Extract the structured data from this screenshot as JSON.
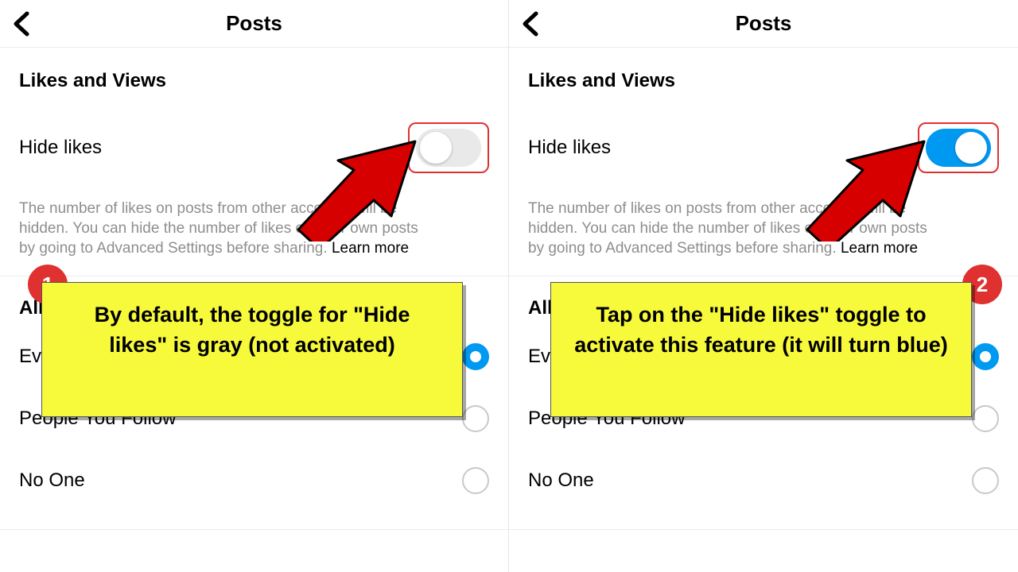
{
  "left": {
    "header_title": "Posts",
    "section_title": "Likes and Views",
    "hide_likes_label": "Hide likes",
    "toggle_on": false,
    "desc_line1": "The number of likes on posts from other accounts will be",
    "desc_line2": "hidden. You can hide the number of likes on your own posts",
    "desc_line3": "by going to Advanced Settings before sharing. ",
    "learn_more": "Learn more",
    "allow_title_visible": "All",
    "option_everyone_visible": "Ev",
    "option_people": "People You Follow",
    "option_noone": "No One",
    "step_number": "1",
    "callout_text": "By default, the toggle for \"Hide likes\" is gray (not activated)"
  },
  "right": {
    "header_title": "Posts",
    "section_title": "Likes and Views",
    "hide_likes_label": "Hide likes",
    "toggle_on": true,
    "desc_line1": "The number of likes on posts from other accounts will be",
    "desc_line2": "hidden. You can hide the number of likes on your own posts",
    "desc_line3": "by going to Advanced Settings before sharing. ",
    "learn_more": "Learn more",
    "allow_title_visible": "All",
    "option_everyone_visible": "Ev",
    "option_people": "People You Follow",
    "option_noone": "No One",
    "step_number": "2",
    "callout_text": "Tap on the \"Hide likes\" toggle to activate this feature (it will turn blue)"
  },
  "colors": {
    "accent": "#0099f2",
    "highlight_border": "#e03131",
    "callout_bg": "#f7f93b"
  }
}
